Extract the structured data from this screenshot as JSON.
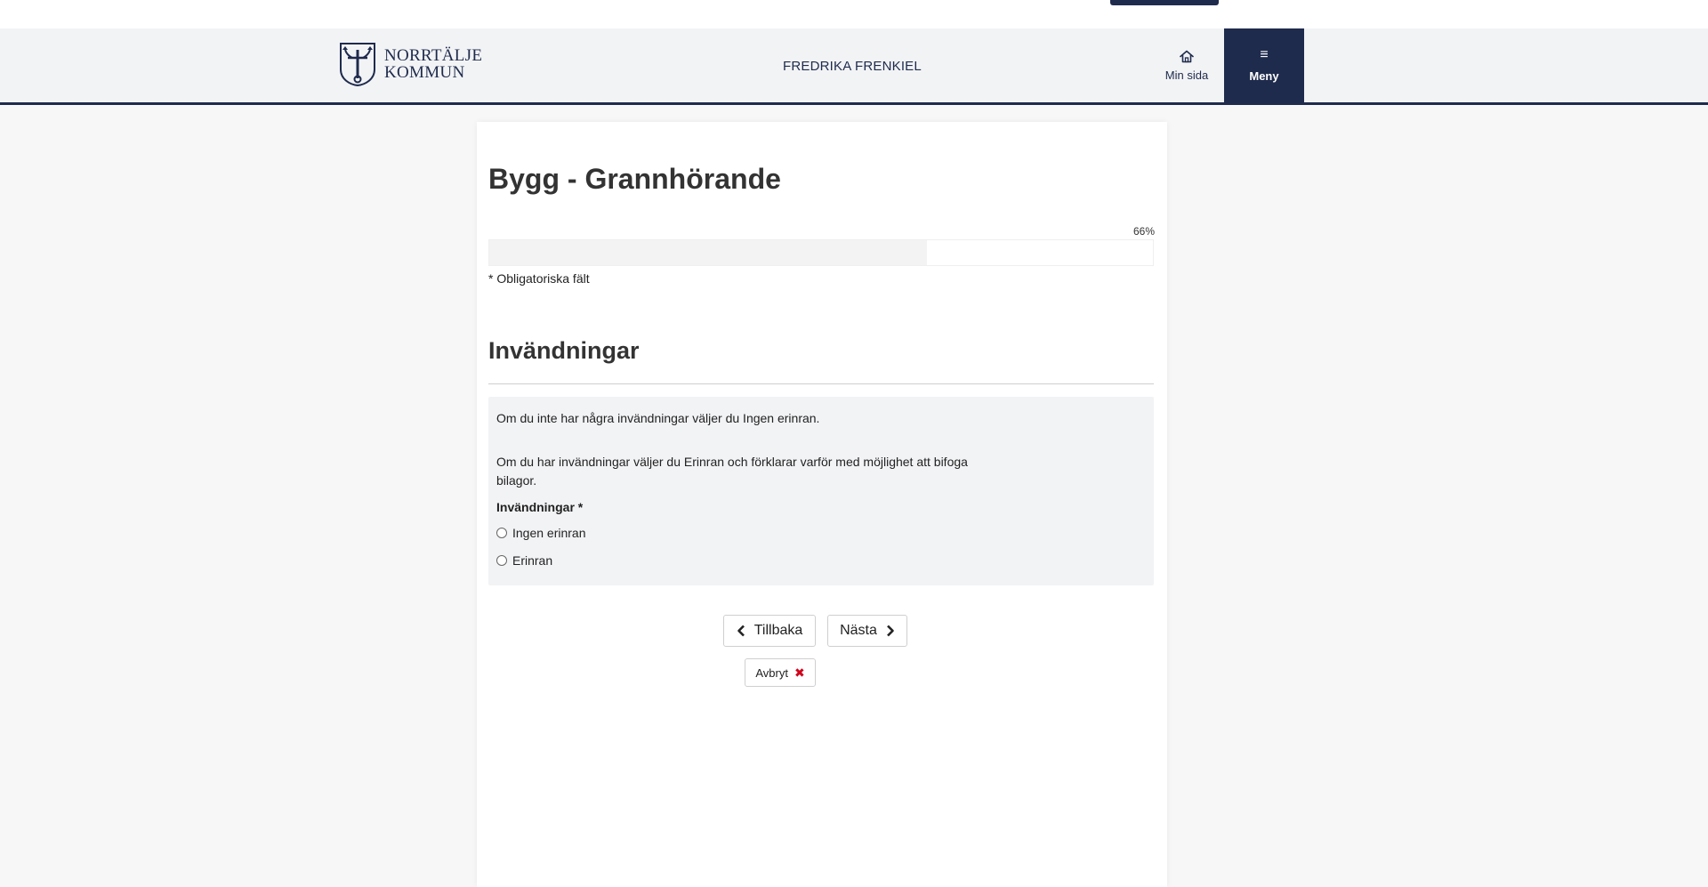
{
  "header": {
    "logo_line1": "NORRTÄLJE",
    "logo_line2": "KOMMUN",
    "user_name": "FREDRIKA FRENKIEL",
    "home_label": "Min sida",
    "menu_label": "Meny",
    "menu_icon": "≡"
  },
  "form": {
    "title": "Bygg - Grannhörande",
    "progress_percent": 66,
    "progress_label": "66%",
    "required_note": "* Obligatoriska fält",
    "section_title": "Invändningar",
    "info_p1": "Om du inte har några invändningar väljer du Ingen erinran.",
    "info_p2": "Om du har invändningar väljer du Erinran och förklarar varför med möjlighet att bifoga bilagor.",
    "field_label": "Invändningar *",
    "options": [
      "Ingen erinran",
      "Erinran"
    ]
  },
  "buttons": {
    "back": "Tillbaka",
    "next": "Nästa",
    "cancel": "Avbryt"
  },
  "colors": {
    "brand": "#1f2b4d",
    "cancel_x": "#d0021b"
  },
  "icons": {
    "home": "home-icon",
    "menu": "hamburger-icon",
    "back": "chevron-left-icon",
    "next": "chevron-right-icon",
    "cancel": "close-icon"
  }
}
